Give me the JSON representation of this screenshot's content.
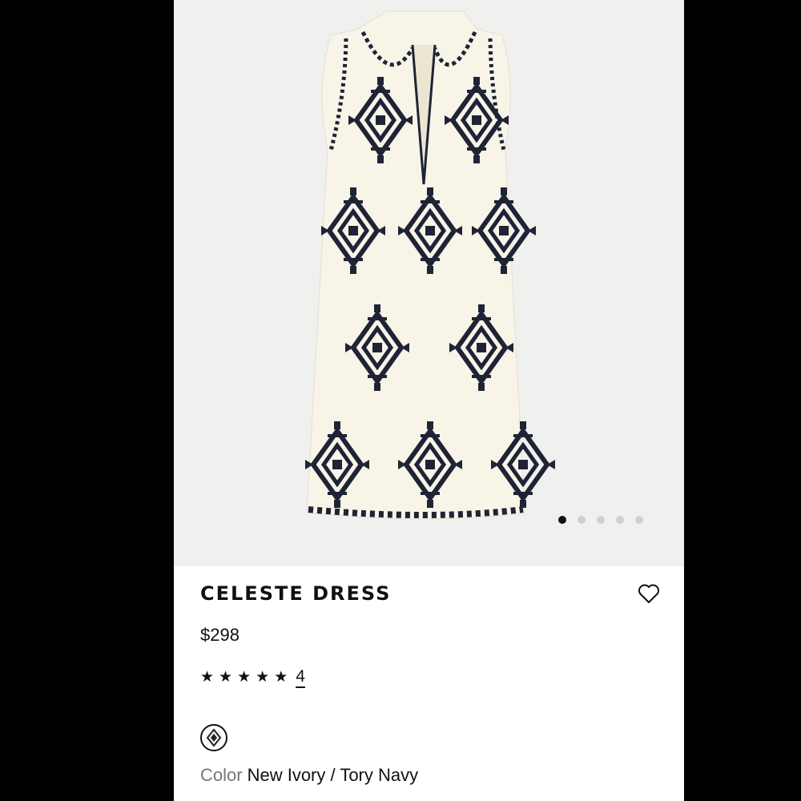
{
  "product": {
    "name": "CELESTE DRESS",
    "price": "$298",
    "rating": 5,
    "rating_max": 5,
    "review_count": "4",
    "color_label": "Color",
    "color_value": "New Ivory / Tory Navy"
  },
  "gallery": {
    "image_count": 5,
    "active_index": 0
  },
  "icons": {
    "wishlist": "heart-outline-icon",
    "rating": "star-icon",
    "swatch": "pattern-swatch-icon"
  },
  "colors": {
    "dress": "#f8f4e8",
    "embroidery": "#1e2436",
    "background": "#f0f0ef",
    "text": "#111111",
    "muted": "#777777"
  }
}
